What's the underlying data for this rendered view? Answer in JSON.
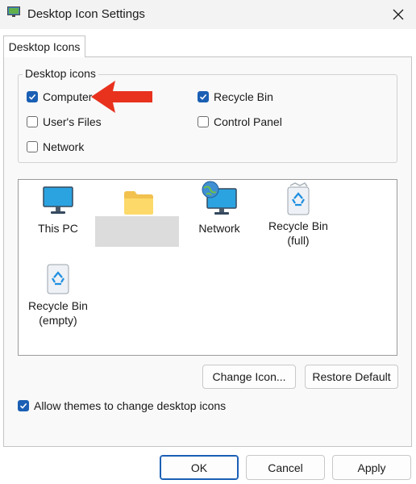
{
  "window": {
    "title": "Desktop Icon Settings"
  },
  "tabs": [
    {
      "label": "Desktop Icons"
    }
  ],
  "group": {
    "label": "Desktop icons",
    "checkboxes": [
      {
        "label": "Computer",
        "checked": true
      },
      {
        "label": "Recycle Bin",
        "checked": true
      },
      {
        "label": "User's Files",
        "checked": false
      },
      {
        "label": "Control Panel",
        "checked": false
      },
      {
        "label": "Network",
        "checked": false
      }
    ]
  },
  "icons": [
    {
      "label": "This PC",
      "icon": "monitor-icon"
    },
    {
      "label": "",
      "icon": "folder-icon"
    },
    {
      "label": "Network",
      "icon": "network-icon"
    },
    {
      "label_line1": "Recycle Bin",
      "label_line2": "(full)",
      "icon": "recycle-bin-full-icon"
    },
    {
      "label_line1": "Recycle Bin",
      "label_line2": "(empty)",
      "icon": "recycle-bin-empty-icon"
    }
  ],
  "buttons": {
    "change_icon": "Change Icon...",
    "restore_default": "Restore Default",
    "ok": "OK",
    "cancel": "Cancel",
    "apply": "Apply"
  },
  "allow_themes": {
    "label": "Allow themes to change desktop icons",
    "checked": true
  },
  "colors": {
    "accent": "#1a5fb4",
    "annotation_arrow": "#e8321e"
  }
}
